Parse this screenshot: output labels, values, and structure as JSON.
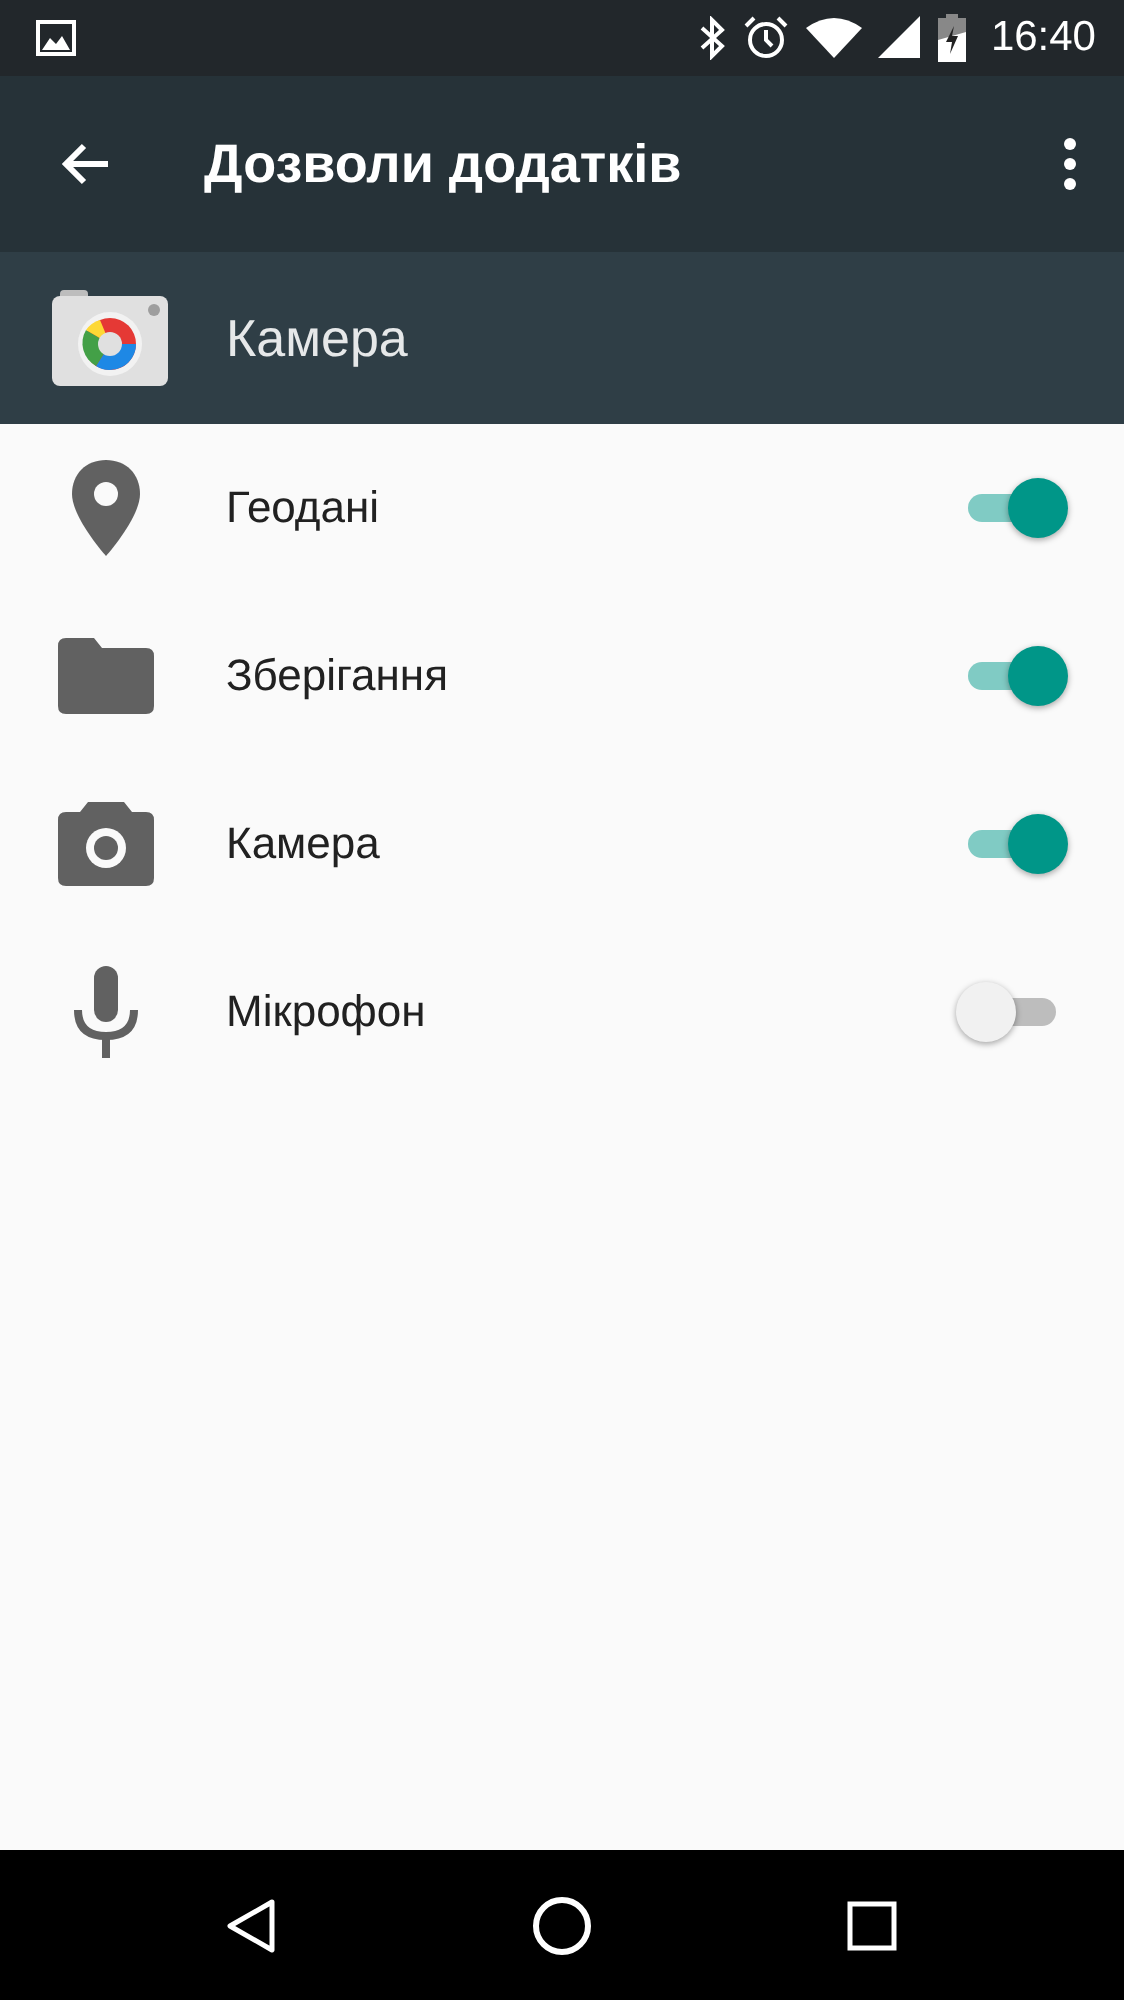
{
  "status_bar": {
    "time": "16:40"
  },
  "toolbar": {
    "title": "Дозволи додатків"
  },
  "app": {
    "name": "Камера"
  },
  "permissions": [
    {
      "kind": "location",
      "label": "Геодані",
      "on": true
    },
    {
      "kind": "folder",
      "label": "Зберігання",
      "on": true
    },
    {
      "kind": "camera",
      "label": "Камера",
      "on": true
    },
    {
      "kind": "mic",
      "label": "Мікрофон",
      "on": false
    }
  ]
}
